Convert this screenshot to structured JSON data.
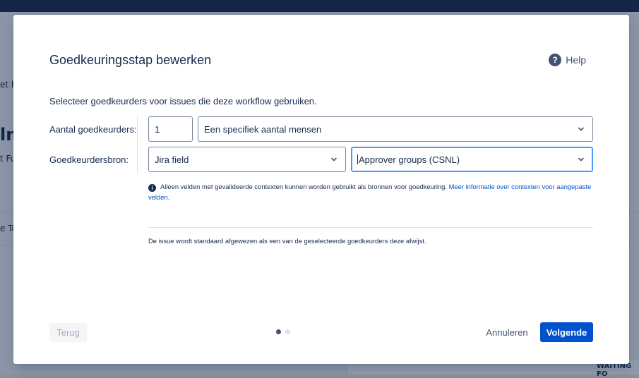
{
  "background": {
    "text_1": "et b",
    "text_2": "lm",
    "text_3": "t Fu",
    "text_4": "e To",
    "text_5": "WAITING FO"
  },
  "modal": {
    "title": "Goedkeuringsstap bewerken",
    "help_label": "Help",
    "intro": "Selecteer goedkeurders voor issues die deze workflow gebruiken.",
    "approvers_count": {
      "label": "Aantal goedkeurders:",
      "value": "1",
      "mode_selected": "Een specifiek aantal mensen"
    },
    "approvers_source": {
      "label": "Goedkeurdersbron:",
      "source_selected": "Jira field",
      "field_selected": "Approver groups (CSNL)"
    },
    "info": {
      "text": "Alleen velden met gevalideerde contexten kunnen worden gebruikt als bronnen voor goedkeuring.",
      "link": "Meer informatie over contexten voor aangepaste velden."
    },
    "note": "De issue wordt standaard afgewezen als een van de geselecteerde goedkeurders deze afwijst.",
    "footer": {
      "back_label": "Terug",
      "cancel_label": "Annuleren",
      "next_label": "Volgende",
      "step_current": 1,
      "step_total": 2
    }
  },
  "colors": {
    "primary": "#0052cc",
    "text": "#172b4d",
    "focus": "#4c9aff"
  },
  "icons": {
    "help": "question-circle-icon",
    "info": "info-circle-icon",
    "dropdown": "chevron-down-icon"
  }
}
